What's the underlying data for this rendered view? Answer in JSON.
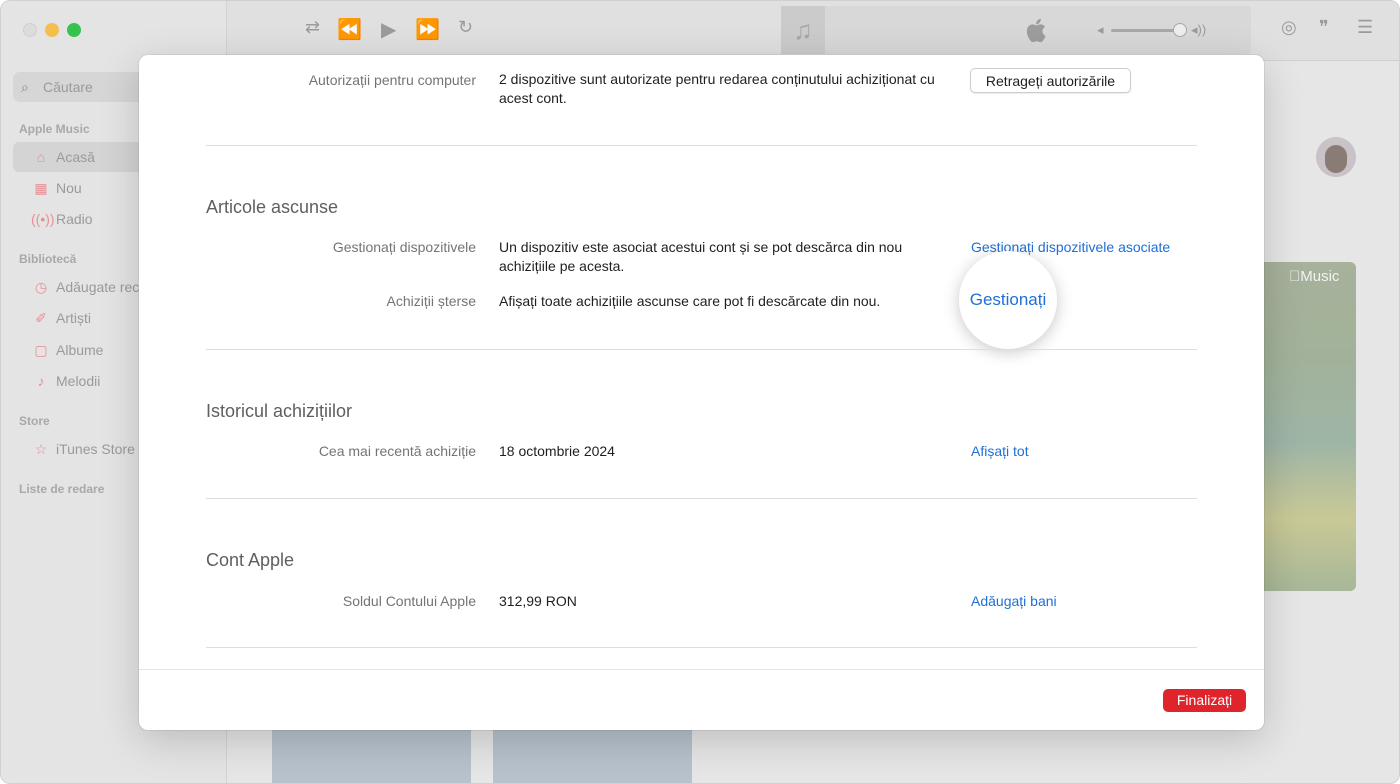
{
  "sidebar": {
    "search_placeholder": "Căutare",
    "sections": {
      "apple_music": "Apple Music",
      "library": "Bibliotecă",
      "store": "Store",
      "playlists": "Liste de redare"
    },
    "items": {
      "home": "Acasă",
      "new": "Nou",
      "radio": "Radio",
      "recently_added": "Adăugate recent",
      "artists": "Artiști",
      "albums": "Albume",
      "songs": "Melodii",
      "itunes_store": "iTunes Store"
    }
  },
  "promo": {
    "brand": "Music"
  },
  "dialog": {
    "authorizations": {
      "label": "Autorizații pentru computer",
      "value": "2 dispozitive sunt autorizate pentru redarea conținutului achiziționat cu acest cont.",
      "button": "Retrageți autorizările"
    },
    "hidden_items": {
      "heading": "Articole ascunse",
      "manage_devices_label": "Gestionați dispozitivele",
      "manage_devices_value": "Un dispozitiv este asociat acestui cont și se pot descărca din nou achizițiile pe acesta.",
      "manage_devices_link": "Gestionați dispozitivele asociate",
      "deleted_purchases_label": "Achiziții șterse",
      "deleted_purchases_value": "Afișați toate achizițiile ascunse care pot fi descărcate din nou.",
      "deleted_purchases_link": "Gestionați"
    },
    "purchase_history": {
      "heading": "Istoricul achizițiilor",
      "recent_label": "Cea mai recentă achiziție",
      "recent_value": "18 octombrie 2024",
      "link": "Afișați tot"
    },
    "apple_account": {
      "heading": "Cont Apple",
      "balance_label": "Soldul Contului Apple",
      "balance_value": "312,99 RON",
      "link": "Adăugați bani"
    },
    "done_button": "Finalizați"
  }
}
